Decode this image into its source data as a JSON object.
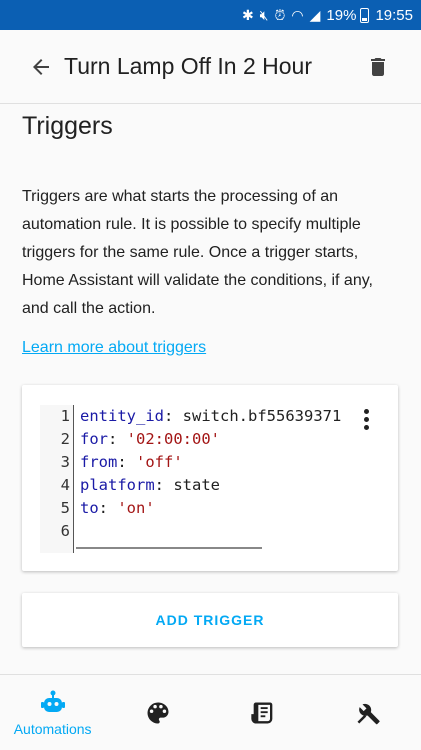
{
  "status_bar": {
    "battery": "19%",
    "time": "19:55",
    "icons": [
      "bluetooth-icon",
      "mute-icon",
      "alarm-icon",
      "wifi-icon",
      "signal-icon",
      "battery-icon"
    ]
  },
  "app_bar": {
    "title": "Turn Lamp Off In 2 Hour",
    "back_icon": "arrow-back-icon",
    "delete_icon": "trash-icon"
  },
  "section": {
    "title": "Triggers",
    "description": "Triggers are what starts the processing of an automation rule. It is possible to specify multiple triggers for the same rule. Once a trigger starts, Home Assistant will validate the conditions, if any, and call the action.",
    "link": "Learn more about triggers"
  },
  "editor": {
    "lines": [
      {
        "num": "1",
        "key": "entity_id",
        "value": "switch.bf55639371",
        "type": "plain"
      },
      {
        "num": "2",
        "key": "for",
        "value": "'02:00:00'",
        "type": "string"
      },
      {
        "num": "3",
        "key": "from",
        "value": "'off'",
        "type": "string"
      },
      {
        "num": "4",
        "key": "platform",
        "value": "state",
        "type": "plain"
      },
      {
        "num": "5",
        "key": "to",
        "value": "'on'",
        "type": "string"
      },
      {
        "num": "6",
        "key": "",
        "value": "",
        "type": "plain"
      }
    ]
  },
  "add_trigger_label": "ADD TRIGGER",
  "bottom_nav": {
    "items": [
      {
        "label": "Automations",
        "icon": "robot-icon",
        "active": true
      },
      {
        "label": "",
        "icon": "palette-icon",
        "active": false
      },
      {
        "label": "",
        "icon": "script-icon",
        "active": false
      },
      {
        "label": "",
        "icon": "tools-icon",
        "active": false
      }
    ]
  },
  "colors": {
    "status_bar": "#0b5fb3",
    "accent": "#03a9f4",
    "yaml_key": "#1a1aa6",
    "yaml_string": "#a31515"
  }
}
